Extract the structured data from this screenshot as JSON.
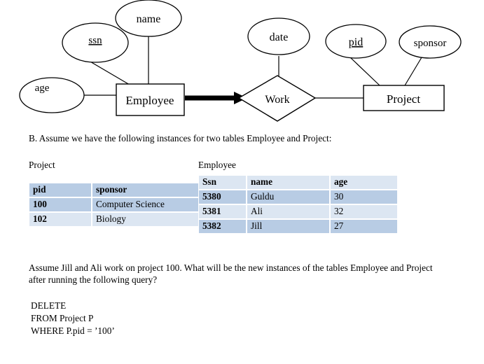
{
  "er_diagram": {
    "entities": [
      {
        "name": "Employee",
        "label": "Employee"
      },
      {
        "name": "Project",
        "label": "Project"
      }
    ],
    "relationships": [
      {
        "name": "Work",
        "label": "Work"
      }
    ],
    "attributes": [
      {
        "name": "age",
        "label": "age",
        "key": false,
        "owner": "Employee"
      },
      {
        "name": "ssn",
        "label": "ssn",
        "key": true,
        "owner": "Employee"
      },
      {
        "name": "name",
        "label": "name",
        "key": false,
        "owner": "Employee"
      },
      {
        "name": "date",
        "label": "date",
        "key": false,
        "owner": "Work"
      },
      {
        "name": "pid",
        "label": "pid",
        "key": true,
        "owner": "Project"
      },
      {
        "name": "sponsor",
        "label": "sponsor",
        "key": false,
        "owner": "Project"
      }
    ]
  },
  "section_b": {
    "text": "B. Assume we have the following instances for two tables Employee and Project:"
  },
  "project_table": {
    "caption": "Project",
    "headers": [
      "pid",
      "sponsor"
    ],
    "rows": [
      [
        "100",
        "Computer Science"
      ],
      [
        "102",
        "Biology"
      ]
    ]
  },
  "employee_table": {
    "caption": "Employee",
    "headers": [
      "Ssn",
      "name",
      "age"
    ],
    "rows": [
      [
        "5380",
        "Guldu",
        "30"
      ],
      [
        "5381",
        "Ali",
        "32"
      ],
      [
        "5382",
        "Jill",
        "27"
      ]
    ]
  },
  "question": {
    "text": "Assume Jill and Ali work on project 100. What will be the new instances of the tables Employee and Project after running the following query?"
  },
  "query": {
    "lines": [
      "DELETE",
      "FROM Project P",
      "WHERE P.pid = ’100’"
    ],
    "text": "DELETE\nFROM Project P\nWHERE P.pid = ’100’"
  },
  "colors": {
    "table_header_fill": "#b8cce4",
    "table_row_alt_fill": "#dce6f2",
    "table_grid": "#ffffff",
    "diagram_stroke": "#000000"
  }
}
